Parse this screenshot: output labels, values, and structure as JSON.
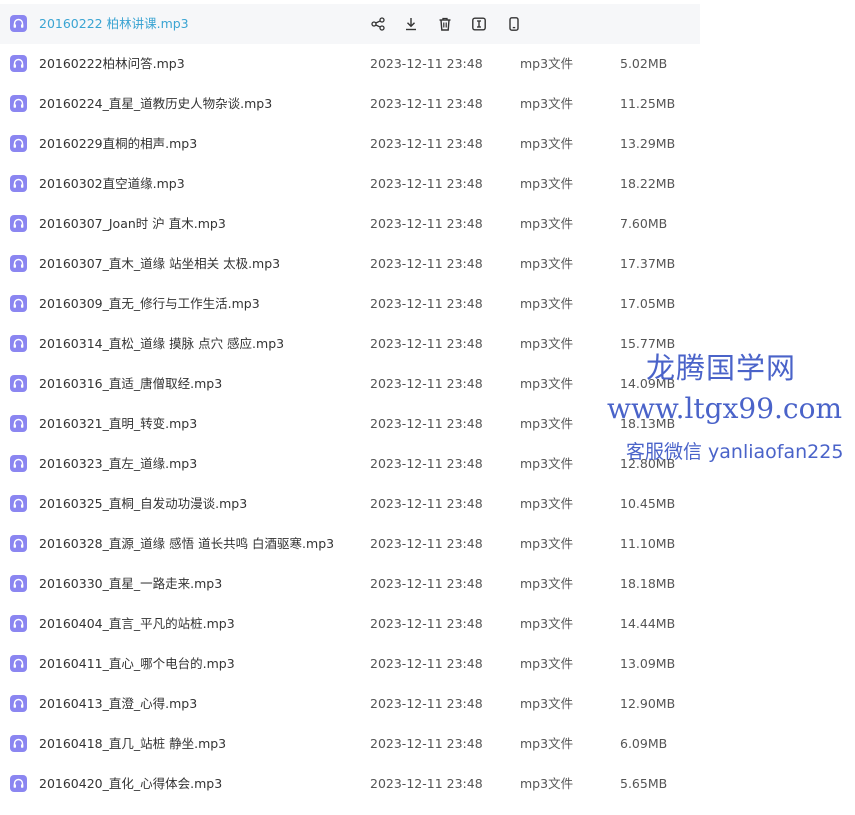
{
  "hover_actions": [
    "share-icon",
    "download-icon",
    "delete-icon",
    "rename-icon",
    "phone-icon"
  ],
  "colors": {
    "file_icon": "#8b86f1",
    "hover_text": "#3aa4d2",
    "watermark": "#4a63c9"
  },
  "files": [
    {
      "name": "20160222 柏林讲课.mp3",
      "date": "",
      "type": "",
      "size": ""
    },
    {
      "name": "20160222柏林问答.mp3",
      "date": "2023-12-11 23:48",
      "type": "mp3文件",
      "size": "5.02MB"
    },
    {
      "name": "20160224_直星_道教历史人物杂谈.mp3",
      "date": "2023-12-11 23:48",
      "type": "mp3文件",
      "size": "11.25MB"
    },
    {
      "name": "20160229直桐的相声.mp3",
      "date": "2023-12-11 23:48",
      "type": "mp3文件",
      "size": "13.29MB"
    },
    {
      "name": "20160302直空道缘.mp3",
      "date": "2023-12-11 23:48",
      "type": "mp3文件",
      "size": "18.22MB"
    },
    {
      "name": "20160307_Joan时 沪 直木.mp3",
      "date": "2023-12-11 23:48",
      "type": "mp3文件",
      "size": "7.60MB"
    },
    {
      "name": "20160307_直木_道缘 站坐相关 太极.mp3",
      "date": "2023-12-11 23:48",
      "type": "mp3文件",
      "size": "17.37MB"
    },
    {
      "name": "20160309_直无_修行与工作生活.mp3",
      "date": "2023-12-11 23:48",
      "type": "mp3文件",
      "size": "17.05MB"
    },
    {
      "name": "20160314_直松_道缘 摸脉 点穴 感应.mp3",
      "date": "2023-12-11 23:48",
      "type": "mp3文件",
      "size": "15.77MB"
    },
    {
      "name": "20160316_直适_唐僧取经.mp3",
      "date": "2023-12-11 23:48",
      "type": "mp3文件",
      "size": "14.09MB"
    },
    {
      "name": "20160321_直明_转变.mp3",
      "date": "2023-12-11 23:48",
      "type": "mp3文件",
      "size": "18.13MB"
    },
    {
      "name": "20160323_直左_道缘.mp3",
      "date": "2023-12-11 23:48",
      "type": "mp3文件",
      "size": "12.80MB"
    },
    {
      "name": "20160325_直桐_自发动功漫谈.mp3",
      "date": "2023-12-11 23:48",
      "type": "mp3文件",
      "size": "10.45MB"
    },
    {
      "name": "20160328_直源_道缘 感悟 道长共鸣 白酒驱寒.mp3",
      "date": "2023-12-11 23:48",
      "type": "mp3文件",
      "size": "11.10MB"
    },
    {
      "name": "20160330_直星_一路走来.mp3",
      "date": "2023-12-11 23:48",
      "type": "mp3文件",
      "size": "18.18MB"
    },
    {
      "name": "20160404_直言_平凡的站桩.mp3",
      "date": "2023-12-11 23:48",
      "type": "mp3文件",
      "size": "14.44MB"
    },
    {
      "name": "20160411_直心_哪个电台的.mp3",
      "date": "2023-12-11 23:48",
      "type": "mp3文件",
      "size": "13.09MB"
    },
    {
      "name": "20160413_直澄_心得.mp3",
      "date": "2023-12-11 23:48",
      "type": "mp3文件",
      "size": "12.90MB"
    },
    {
      "name": "20160418_直几_站桩 静坐.mp3",
      "date": "2023-12-11 23:48",
      "type": "mp3文件",
      "size": "6.09MB"
    },
    {
      "name": "20160420_直化_心得体会.mp3",
      "date": "2023-12-11 23:48",
      "type": "mp3文件",
      "size": "5.65MB"
    }
  ],
  "watermark": {
    "line1": "龙腾国学网",
    "line2": "www.ltgx99.com",
    "line3": "客服微信 yanliaofan225"
  }
}
